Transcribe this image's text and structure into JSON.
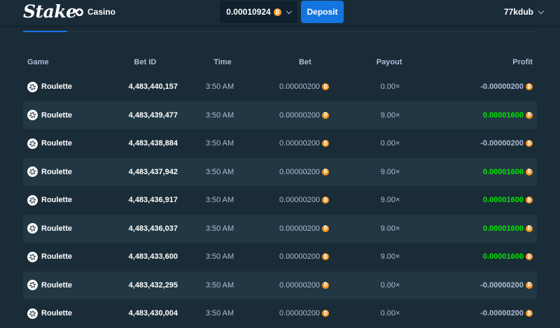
{
  "header": {
    "logo": "Stake",
    "nav_casino": "Casino",
    "balance": "0.00010924",
    "deposit_label": "Deposit",
    "username": "77kdub"
  },
  "table": {
    "columns": [
      "Game",
      "Bet ID",
      "Time",
      "Bet",
      "Payout",
      "Profit"
    ],
    "rows": [
      {
        "game": "Roulette",
        "bet_id": "4,483,440,157",
        "time": "3:50 AM",
        "bet": "0.00000200",
        "payout": "0.00×",
        "profit": "-0.00000200",
        "win": false
      },
      {
        "game": "Roulette",
        "bet_id": "4,483,439,477",
        "time": "3:50 AM",
        "bet": "0.00000200",
        "payout": "9.00×",
        "profit": "0.00001600",
        "win": true
      },
      {
        "game": "Roulette",
        "bet_id": "4,483,438,884",
        "time": "3:50 AM",
        "bet": "0.00000200",
        "payout": "0.00×",
        "profit": "-0.00000200",
        "win": false
      },
      {
        "game": "Roulette",
        "bet_id": "4,483,437,942",
        "time": "3:50 AM",
        "bet": "0.00000200",
        "payout": "9.00×",
        "profit": "0.00001600",
        "win": true
      },
      {
        "game": "Roulette",
        "bet_id": "4,483,436,917",
        "time": "3:50 AM",
        "bet": "0.00000200",
        "payout": "9.00×",
        "profit": "0.00001600",
        "win": true
      },
      {
        "game": "Roulette",
        "bet_id": "4,483,436,037",
        "time": "3:50 AM",
        "bet": "0.00000200",
        "payout": "9.00×",
        "profit": "0.00001600",
        "win": true
      },
      {
        "game": "Roulette",
        "bet_id": "4,483,433,600",
        "time": "3:50 AM",
        "bet": "0.00000200",
        "payout": "9.00×",
        "profit": "0.00001600",
        "win": true
      },
      {
        "game": "Roulette",
        "bet_id": "4,483,432,295",
        "time": "3:50 AM",
        "bet": "0.00000200",
        "payout": "0.00×",
        "profit": "-0.00000200",
        "win": false
      },
      {
        "game": "Roulette",
        "bet_id": "4,483,430,004",
        "time": "3:50 AM",
        "bet": "0.00000200",
        "payout": "0.00×",
        "profit": "-0.00000200",
        "win": false
      }
    ]
  },
  "colors": {
    "background": "#1a2c38",
    "row_alt": "#213743",
    "accent": "#1475e1",
    "win": "#00e701",
    "btc": "#f7931a"
  },
  "icons": {
    "currency": "bitcoin-icon",
    "game": "roulette-icon",
    "casino": "casino-icon"
  }
}
